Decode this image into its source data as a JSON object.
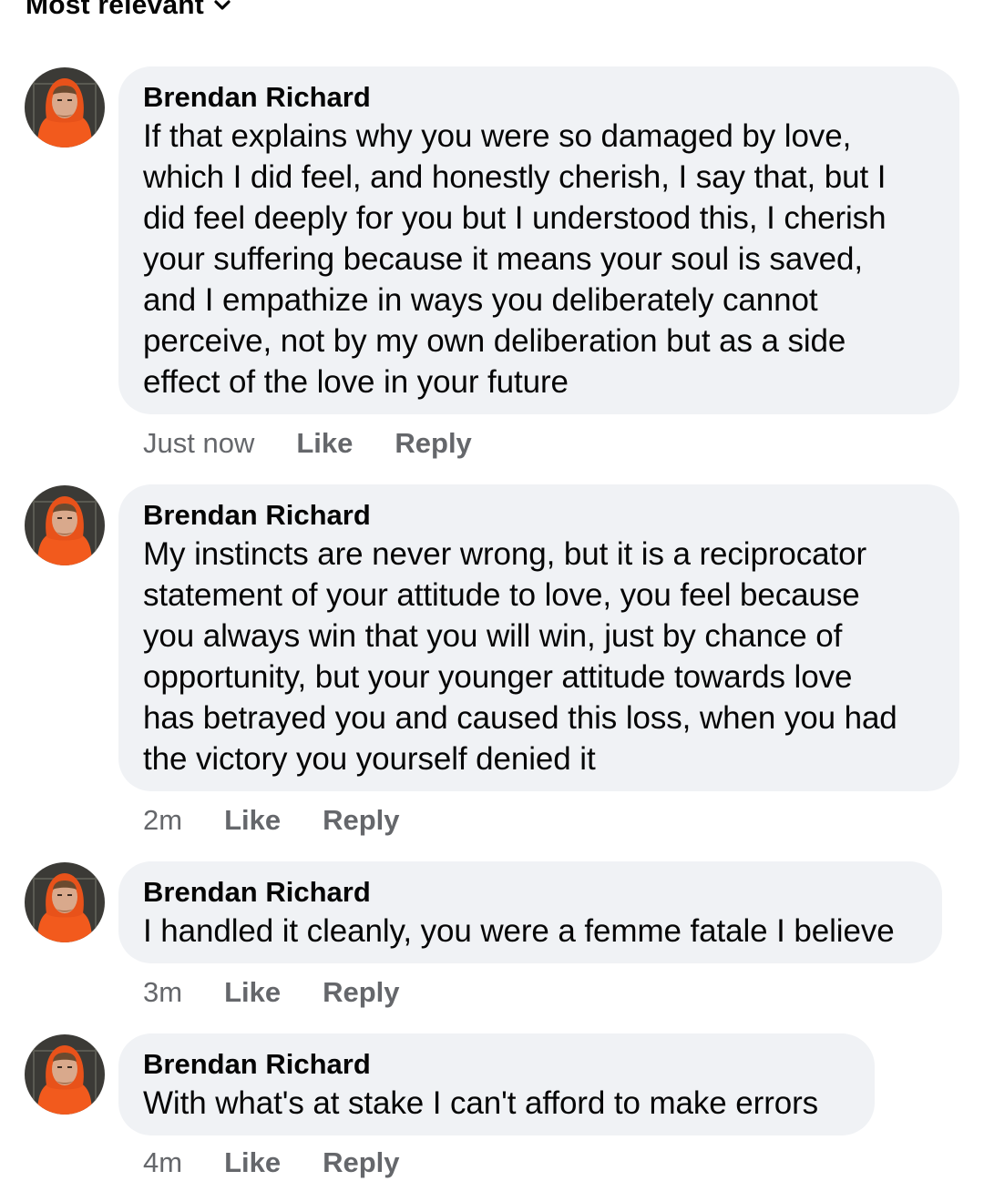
{
  "sort": {
    "label": "Most relevant",
    "icon": "chevron-down-icon"
  },
  "comments": [
    {
      "author": "Brendan Richard",
      "text": "If that explains why you were so damaged by love,\nwhich I did feel, and honestly cherish, I say that, but I\ndid feel deeply for you but I understood this, I cherish\nyour suffering because it means your soul is saved,\nand I empathize in ways you deliberately cannot\nperceive, not by my own deliberation but as a side\neffect of the love in your future",
      "time": "Just now",
      "like": "Like",
      "reply": "Reply"
    },
    {
      "author": "Brendan Richard",
      "text": "My instincts are never wrong, but it is a reciprocator\nstatement of your attitude to love, you feel because\nyou always win that you will win, just by chance of\nopportunity, but your younger attitude towards love\nhas betrayed you and caused this loss, when you had\nthe victory you yourself denied it",
      "time": "2m",
      "like": "Like",
      "reply": "Reply"
    },
    {
      "author": "Brendan Richard",
      "text": "I handled it cleanly, you were a femme fatale I believe",
      "time": "3m",
      "like": "Like",
      "reply": "Reply"
    },
    {
      "author": "Brendan Richard",
      "text": "With what's at stake I can't afford to make errors",
      "time": "4m",
      "like": "Like",
      "reply": "Reply"
    }
  ],
  "colors": {
    "bubble": "#f0f2f5",
    "secondary_text": "#65676b",
    "avatar_jacket": "#f25a1d"
  }
}
